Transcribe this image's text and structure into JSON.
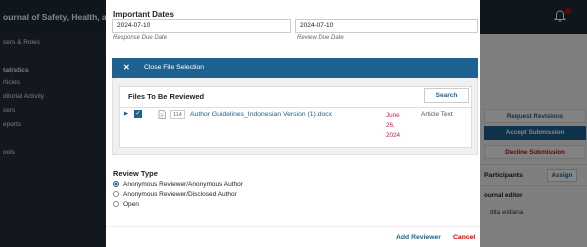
{
  "app": {
    "journal_title": "ournal of Safety, Health, a",
    "bell_icon": "bell-icon"
  },
  "sidebar": {
    "items": [
      {
        "label": "sers & Roles",
        "heading": false
      },
      {
        "label": "tatistics",
        "heading": true
      },
      {
        "label": "rticles",
        "heading": false
      },
      {
        "label": "ditorial Activity",
        "heading": false
      },
      {
        "label": "sers",
        "heading": false
      },
      {
        "label": "eports",
        "heading": false
      },
      {
        "label": "ools",
        "heading": false
      }
    ]
  },
  "right_panel": {
    "request_revisions": "Request Revisions",
    "accept_submission": "Accept Submission",
    "decline_submission": "Decline Submission",
    "participants": "Participants",
    "assign": "Assign",
    "role": "ournal editor",
    "participant_name": "dita widiana"
  },
  "modal": {
    "important_dates_title": "Important Dates",
    "response_due_value": "2024-07-10",
    "response_due_label": "Response Due Date",
    "review_due_value": "2024-07-10",
    "review_due_label": "Review Due Date",
    "file_selection": {
      "close_icon": "✕",
      "close_label": "Close File Selection",
      "title": "Files To Be Reviewed",
      "search_label": "Search",
      "files": [
        {
          "id": "114",
          "name": "Author Guidelines_Indonesian Version (1).docx",
          "date": "June 26, 2024",
          "type": "Article Text",
          "checked": true
        }
      ]
    },
    "review_type_title": "Review Type",
    "review_types": [
      {
        "label": "Anonymous Reviewer/Anonymous Author",
        "checked": true
      },
      {
        "label": "Anonymous Reviewer/Disclosed Author",
        "checked": false
      },
      {
        "label": "Open",
        "checked": false
      }
    ],
    "add_reviewer": "Add Reviewer",
    "cancel": "Cancel"
  },
  "colors": {
    "accent": "#1e6292",
    "danger": "#dd0000",
    "date_color": "#c2185b",
    "topbar": "#202b38"
  }
}
